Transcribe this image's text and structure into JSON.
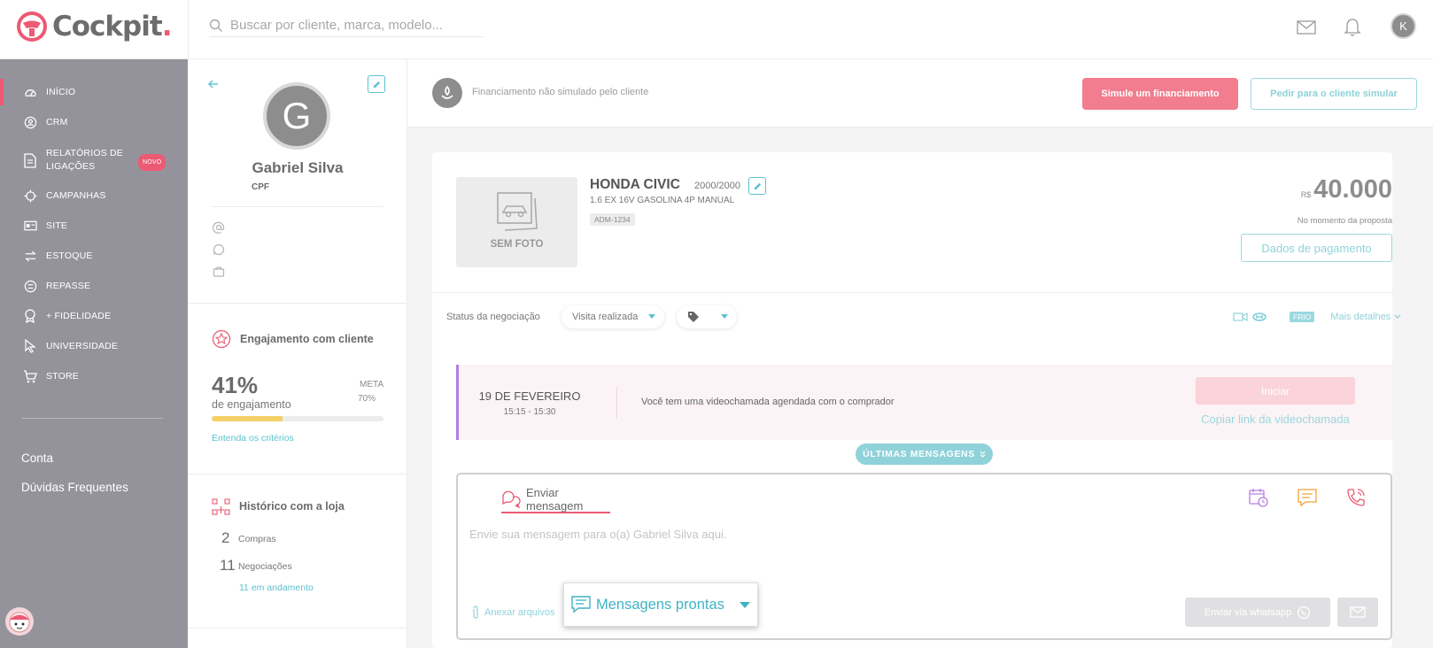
{
  "app": {
    "logo_text": "Cockpit",
    "logo_dot": "."
  },
  "search": {
    "placeholder": "Buscar por cliente, marca, modelo..."
  },
  "user": {
    "initial": "K"
  },
  "sidebar": {
    "items": [
      {
        "label": "INÍCIO",
        "icon": "dashboard-icon"
      },
      {
        "label": "CRM",
        "icon": "user-circle-icon"
      },
      {
        "label": "RELATÓRIOS DE LIGAÇÕES",
        "icon": "document-icon",
        "badge": "NOVO"
      },
      {
        "label": "CAMPANHAS",
        "icon": "target-icon"
      },
      {
        "label": "SITE",
        "icon": "id-card-icon"
      },
      {
        "label": "ESTOQUE",
        "icon": "transfer-icon"
      },
      {
        "label": "REPASSE",
        "icon": "exchange-circle-icon"
      },
      {
        "label": "+ FIDELIDADE",
        "icon": "award-icon"
      },
      {
        "label": "UNIVERSIDADE",
        "icon": "cursor-icon"
      },
      {
        "label": "STORE",
        "icon": "cart-icon"
      }
    ],
    "conta": "Conta",
    "duvidas": "Dúvidas Frequentes"
  },
  "profile": {
    "initial": "G",
    "name": "Gabriel Silva",
    "doc_label": "CPF",
    "engagement": {
      "title": "Engajamento com cliente",
      "percent_text": "41%",
      "percent": 41,
      "subtitle": "de engajamento",
      "meta_label": "META",
      "meta_value": "70%",
      "link": "Entenda os critérios"
    },
    "history": {
      "title": "Histórico com a loja",
      "compras_count": "2",
      "compras_label": "Compras",
      "negociacoes_count": "11",
      "negociacoes_label": "Negociações",
      "andamento_link": "11 em andamento"
    }
  },
  "financing": {
    "status_text": "Financiamento não simulado pelo cliente",
    "simulate_button": "Simule um financiamento",
    "ask_button": "Pedir para o cliente simular"
  },
  "vehicle": {
    "no_photo": "SEM FOTO",
    "name": "HONDA CIVIC",
    "year": "2000/2000",
    "description": "1.6 EX 16V GASOLINA 4P MANUAL",
    "plate": "ADM-1234",
    "currency": "R$",
    "price": "40.000",
    "price_note": "No momento da proposta",
    "payment_button": "Dados de pagamento"
  },
  "negotiation": {
    "status_label": "Status da negociação",
    "status_value": "Visita realizada",
    "temperature_badge": "FRIO",
    "more_details": "Mais detalhes"
  },
  "videocall": {
    "date": "19 DE FEVEREIRO",
    "time": "15:15 - 15:30",
    "message": "Você tem uma videochamada agendada com o comprador",
    "start_button": "Iniciar",
    "copy_link": "Copiar link da videochamada"
  },
  "messages": {
    "latest_pill": "ÚLTIMAS MENSAGENS",
    "tab_label": "Enviar mensagem",
    "placeholder": "Envie sua mensagem para o(a) Gabriel Silva aqui.",
    "attach": "Anexar arquivos",
    "ready_messages": "Mensagens prontas",
    "send_whatsapp": "Enviar via whatsapp"
  },
  "colors": {
    "brand_pink": "#ec5a73",
    "accent_teal": "#5bc2cf",
    "sidebar_bg": "#94939c",
    "engagement_bar": "#f4d168",
    "videocall_accent": "#b57de0"
  }
}
